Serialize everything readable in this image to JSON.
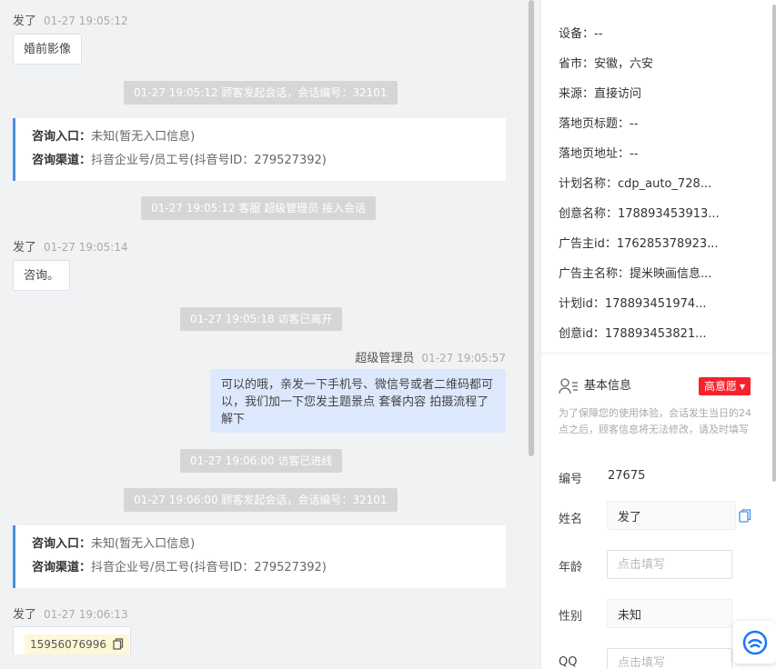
{
  "chat": {
    "messages": [
      {
        "sender": "发了",
        "time": "01-27 19:05:12",
        "text": "婚前影像"
      },
      {
        "system": "01-27 19:05:12 顾客发起会话，会话编号：32101"
      },
      {
        "card": {
          "entry_label": "咨询入口：",
          "entry_value": "未知(暂无入口信息)",
          "channel_label": "咨询渠道：",
          "channel_value": "抖音企业号/员工号(抖音号ID：279527392)"
        }
      },
      {
        "system": "01-27 19:05:12 客服 超级管理员 接入会话"
      },
      {
        "sender": "发了",
        "time": "01-27 19:05:14",
        "text": "咨询。"
      },
      {
        "system": "01-27 19:05:18 访客已离开"
      },
      {
        "agent": "超级管理员",
        "time": "01-27 19:05:57",
        "text": "可以的哦，亲发一下手机号、微信号或者二维码都可以，我们加一下您发主题景点 套餐内容 拍摄流程了解下"
      },
      {
        "system": "01-27 19:06:00 访客已进线"
      },
      {
        "system": "01-27 19:06:00 顾客发起会话，会话编号：32101"
      },
      {
        "card": {
          "entry_label": "咨询入口：",
          "entry_value": "未知(暂无入口信息)",
          "channel_label": "咨询渠道：",
          "channel_value": "抖音企业号/员工号(抖音号ID：279527392)"
        }
      },
      {
        "sender": "发了",
        "time": "01-27 19:06:13",
        "phone": "15956076996"
      }
    ]
  },
  "source_info": {
    "rows": [
      {
        "label": "设备：",
        "value": "--"
      },
      {
        "label": "省市：",
        "value": "安徽，六安"
      },
      {
        "label": "来源：",
        "value": "直接访问"
      },
      {
        "label": "落地页标题：",
        "value": "--"
      },
      {
        "label": "落地页地址：",
        "value": "--"
      },
      {
        "label": "计划名称：",
        "value": "cdp_auto_728..."
      },
      {
        "label": "创意名称：",
        "value": "178893453913..."
      },
      {
        "label": "广告主id：",
        "value": "176285378923..."
      },
      {
        "label": "广告主名称：",
        "value": "提米映画信息..."
      },
      {
        "label": "计划id：",
        "value": "178893451974..."
      },
      {
        "label": "创意id：",
        "value": "178893453821..."
      }
    ]
  },
  "basic_info": {
    "title": "基本信息",
    "intent_badge": "高意愿",
    "hint": "为了保障您的使用体验，会话发生当日的24点之后，顾客信息将无法修改，请及时填写",
    "id_label": "编号",
    "id_value": "27675",
    "name_label": "姓名",
    "name_value": "发了",
    "age_label": "年龄",
    "age_placeholder": "点击填写",
    "gender_label": "性别",
    "gender_value": "未知",
    "qq_label": "QQ",
    "qq_placeholder": "点击填写"
  },
  "colors": {
    "accent": "#4a90e2",
    "badge": "#f5222d",
    "agent_bubble": "#dce9fd"
  }
}
